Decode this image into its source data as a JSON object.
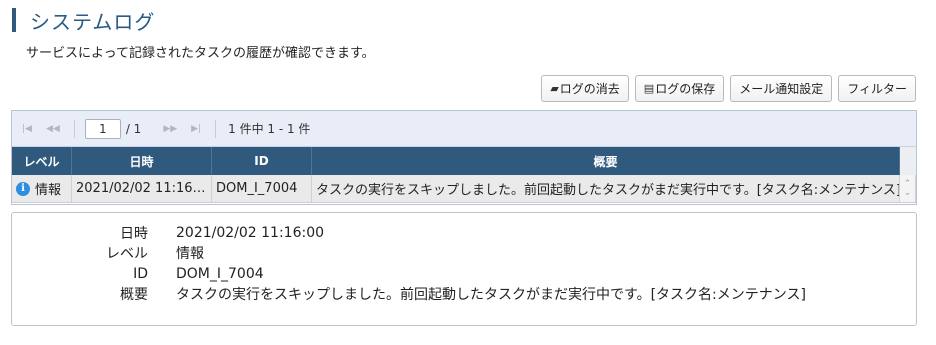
{
  "page": {
    "title": "システムログ",
    "subtitle": "サービスによって記録されたタスクの履歴が確認できます。"
  },
  "toolbar": {
    "clear_label": "ログの消去",
    "save_label": "ログの保存",
    "mail_label": "メール通知設定",
    "filter_label": "フィルター"
  },
  "pager": {
    "current_page": "1",
    "total_pages": "/ 1",
    "info": "1 件中 1 - 1 件"
  },
  "table": {
    "columns": [
      "レベル",
      "日時",
      "ID",
      "概要"
    ],
    "rows": [
      {
        "level": "情報",
        "datetime": "2021/02/02 11:16:00",
        "id": "DOM_I_7004",
        "summary": "タスクの実行をスキップしました。前回起動したタスクがまだ実行中です。[タスク名:メンテナンス]"
      }
    ]
  },
  "detail": {
    "datetime_label": "日時",
    "datetime_value": "2021/02/02 11:16:00",
    "level_label": "レベル",
    "level_value": "情報",
    "id_label": "ID",
    "id_value": "DOM_I_7004",
    "summary_label": "概要",
    "summary_value": "タスクの実行をスキップしました。前回起動したタスクがまだ実行中です。[タスク名:メンテナンス]"
  },
  "colors": {
    "accent": "#2f5a7e",
    "title": "#2a5a86",
    "info_icon": "#2e8fe0"
  },
  "icons": {
    "clear": "eraser-icon",
    "save": "save-icon",
    "info": "info-icon",
    "first_page": "first-page-icon",
    "prev_page": "prev-page-icon",
    "next_page": "next-page-icon",
    "last_page": "last-page-icon"
  }
}
